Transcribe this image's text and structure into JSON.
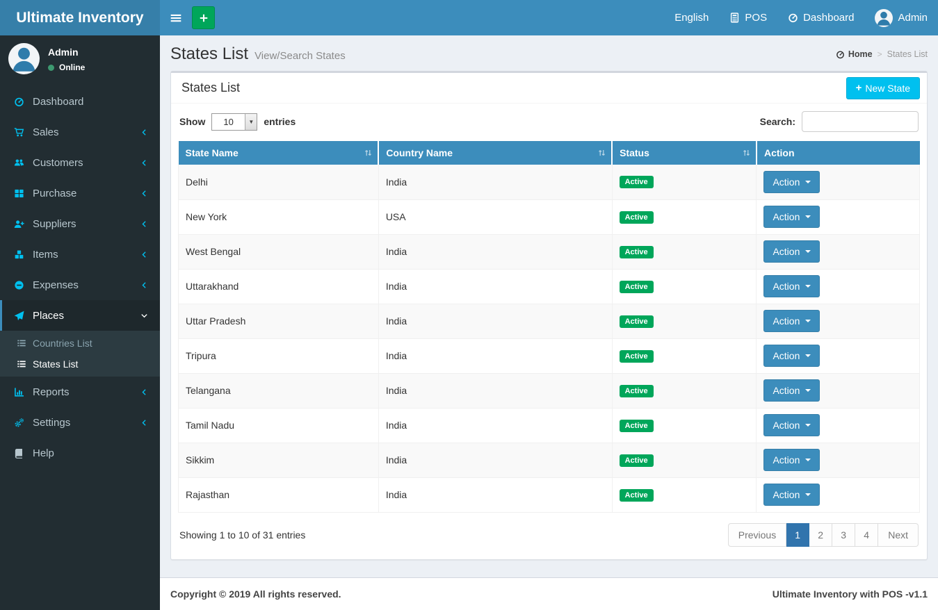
{
  "navbar": {
    "brand": "Ultimate Inventory",
    "language": "English",
    "pos_label": "POS",
    "dashboard_label": "Dashboard",
    "user_label": "Admin"
  },
  "sidebar": {
    "user": {
      "name": "Admin",
      "status": "Online"
    },
    "items": [
      {
        "id": "dashboard",
        "icon": "speedometer",
        "label": "Dashboard"
      },
      {
        "id": "sales",
        "icon": "cart",
        "label": "Sales",
        "chevron": "left"
      },
      {
        "id": "customers",
        "icon": "users",
        "label": "Customers",
        "chevron": "left"
      },
      {
        "id": "purchase",
        "icon": "grid",
        "label": "Purchase",
        "chevron": "left"
      },
      {
        "id": "suppliers",
        "icon": "user-plus",
        "label": "Suppliers",
        "chevron": "left"
      },
      {
        "id": "items",
        "icon": "cubes",
        "label": "Items",
        "chevron": "left"
      },
      {
        "id": "expenses",
        "icon": "minus-circle",
        "label": "Expenses",
        "chevron": "left"
      },
      {
        "id": "places",
        "icon": "paper-plane",
        "label": "Places",
        "chevron": "down",
        "active": true,
        "submenu": [
          {
            "id": "countries-list",
            "icon": "list",
            "label": "Countries List"
          },
          {
            "id": "states-list",
            "icon": "list",
            "label": "States List",
            "active": true
          }
        ]
      },
      {
        "id": "reports",
        "icon": "bar-chart",
        "label": "Reports",
        "chevron": "left"
      },
      {
        "id": "settings",
        "icon": "gears",
        "label": "Settings",
        "chevron": "left"
      },
      {
        "id": "help",
        "icon": "book",
        "label": "Help"
      }
    ]
  },
  "content_header": {
    "title": "States List",
    "subtitle": "View/Search States",
    "breadcrumb": {
      "home": "Home",
      "separator": ">",
      "current": "States List"
    }
  },
  "panel": {
    "title": "States List",
    "new_button_icon": "+",
    "new_button": "New State"
  },
  "toolbar": {
    "show_label": "Show",
    "page_length": "10",
    "entries_label": "entries",
    "search_label": "Search:",
    "search_value": ""
  },
  "table": {
    "columns": [
      {
        "label": "State Name",
        "sortable": true
      },
      {
        "label": "Country Name",
        "sortable": true
      },
      {
        "label": "Status",
        "sortable": true
      },
      {
        "label": "Action",
        "sortable": false
      }
    ],
    "action_label": "Action",
    "rows": [
      {
        "state": "Delhi",
        "country": "India",
        "status": "Active"
      },
      {
        "state": "New York",
        "country": "USA",
        "status": "Active"
      },
      {
        "state": "West Bengal",
        "country": "India",
        "status": "Active"
      },
      {
        "state": "Uttarakhand",
        "country": "India",
        "status": "Active"
      },
      {
        "state": "Uttar Pradesh",
        "country": "India",
        "status": "Active"
      },
      {
        "state": "Tripura",
        "country": "India",
        "status": "Active"
      },
      {
        "state": "Telangana",
        "country": "India",
        "status": "Active"
      },
      {
        "state": "Tamil Nadu",
        "country": "India",
        "status": "Active"
      },
      {
        "state": "Sikkim",
        "country": "India",
        "status": "Active"
      },
      {
        "state": "Rajasthan",
        "country": "India",
        "status": "Active"
      }
    ]
  },
  "pagination": {
    "info": "Showing 1 to 10 of 31 entries",
    "previous": "Previous",
    "pages": [
      "1",
      "2",
      "3",
      "4"
    ],
    "active_page": "1",
    "next": "Next"
  },
  "footer": {
    "copyright": "Copyright © 2019 All rights reserved.",
    "version": "Ultimate Inventory with POS -v1.1"
  },
  "colors": {
    "navbar": "#3c8dbc",
    "logo_bg": "#367fa9",
    "sidebar_bg": "#222d32",
    "submenu_bg": "#2c3b41",
    "sidebar_icon": "#00c0ef",
    "active_left_border": "#3c8dbc",
    "success_badge": "#00a65a",
    "new_button": "#00c0ef",
    "table_header": "#3c8dbc",
    "pagination_active": "#3174ad",
    "content_bg": "#ecf0f5"
  }
}
